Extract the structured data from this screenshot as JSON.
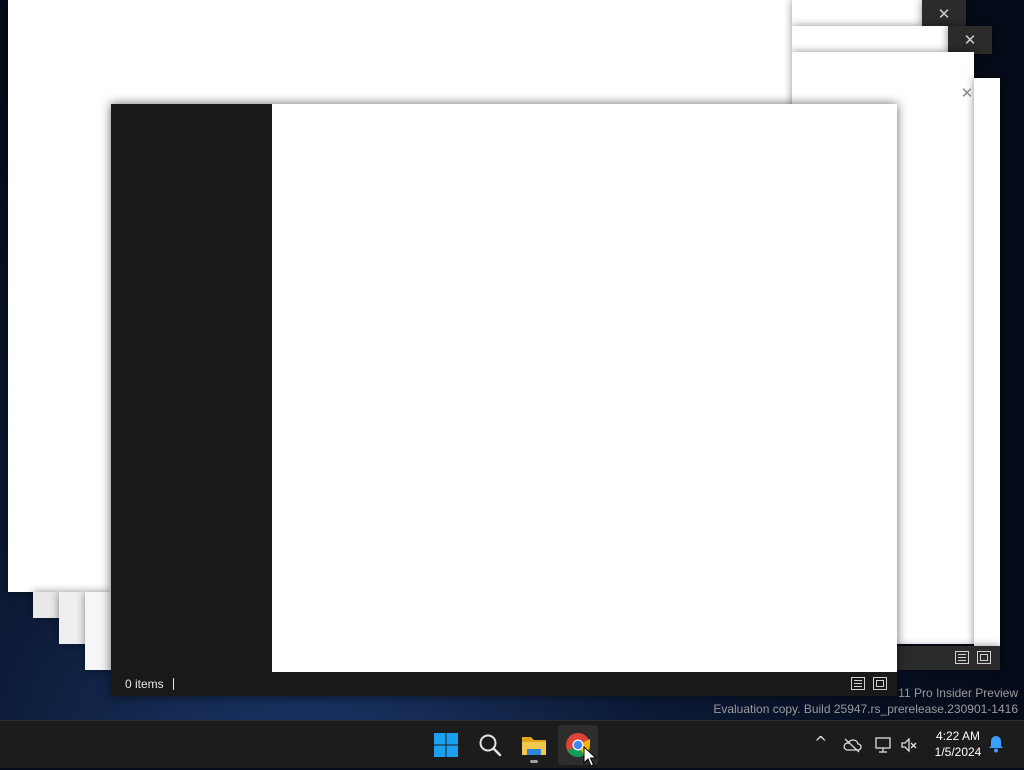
{
  "background_windows": {
    "close_glyph": "✕"
  },
  "explorer": {
    "status_items": "0 items",
    "details_view_label": "Details view",
    "tiles_view_label": "Large icons view"
  },
  "watermark": {
    "line1": "11 Pro Insider Preview",
    "line2": "Evaluation copy. Build 25947.rs_prerelease.230901-1416"
  },
  "taskbar": {
    "apps": [
      {
        "name": "Start",
        "icon": "windows-logo-icon"
      },
      {
        "name": "Search",
        "icon": "search-icon"
      },
      {
        "name": "File Explorer",
        "icon": "folder-icon",
        "running": true
      },
      {
        "name": "Google Chrome",
        "icon": "chrome-icon",
        "active": true
      }
    ],
    "tray": {
      "chevron": "^",
      "time": "4:22 AM",
      "date": "1/5/2024"
    }
  },
  "colors": {
    "taskbar_bg": "#1c1c1c",
    "explorer_bg": "#191919",
    "windows_blue": "#1aa0f0",
    "folder_yellow": "#f2b92b"
  }
}
